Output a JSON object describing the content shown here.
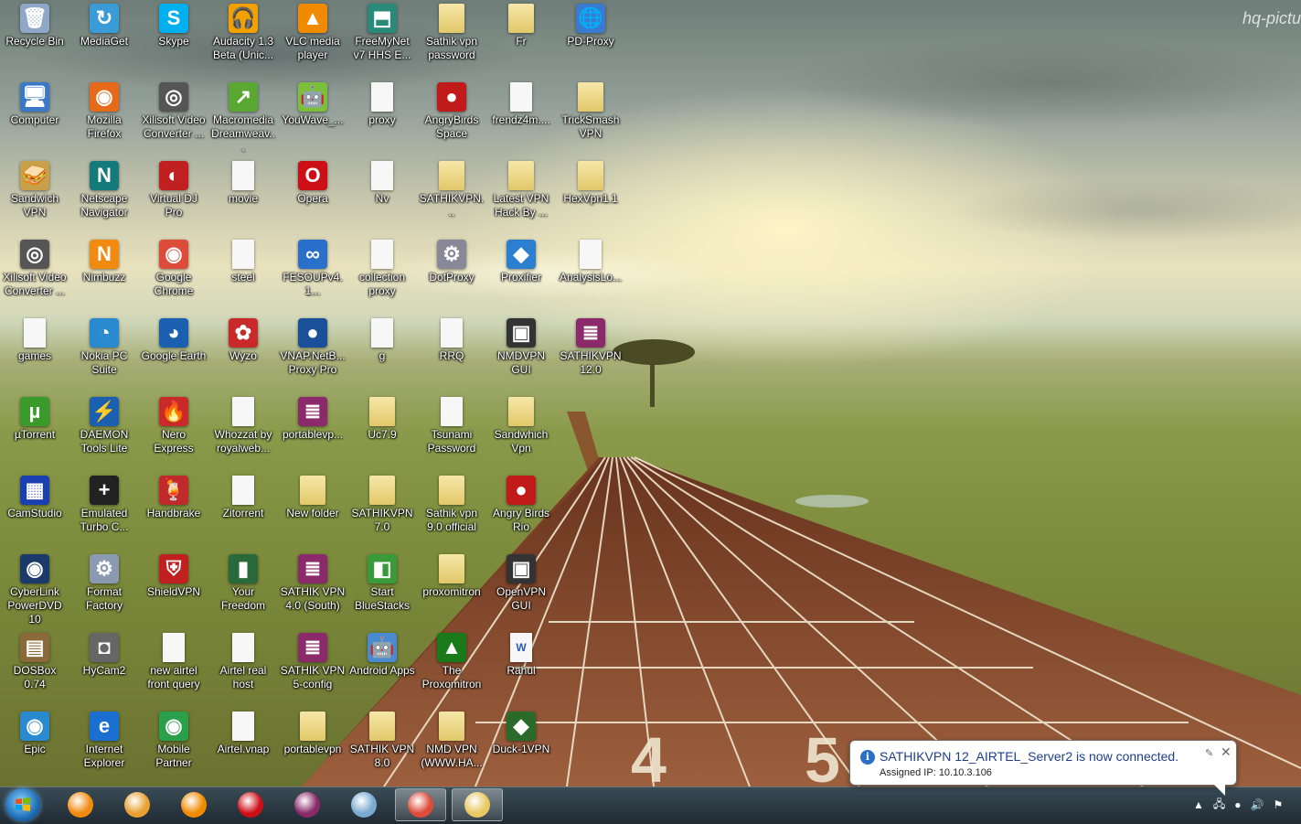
{
  "watermark": "hq-pictu",
  "icons": [
    {
      "label": "Recycle Bin",
      "icon": "recycle-bin-icon",
      "glyph": "🗑",
      "color": "#8fa8c8"
    },
    {
      "label": "MediaGet",
      "icon": "mediaget-icon",
      "glyph": "↻",
      "color": "#3a9bd9"
    },
    {
      "label": "Skype",
      "icon": "skype-icon",
      "glyph": "S",
      "color": "#00aff0"
    },
    {
      "label": "Audacity 1.3 Beta (Unic...",
      "icon": "audacity-icon",
      "glyph": "🎧",
      "color": "#f2a100"
    },
    {
      "label": "VLC media player",
      "icon": "vlc-icon",
      "glyph": "▲",
      "color": "#f08a00"
    },
    {
      "label": "FreeMyNet v7 HHS E...",
      "icon": "freemynet-icon",
      "glyph": "⬒",
      "color": "#2a8a7a"
    },
    {
      "label": "Sathik vpn password",
      "icon": "folder-icon",
      "glyph": "",
      "color": "#e8cf78",
      "kind": "fold"
    },
    {
      "label": "Fr",
      "icon": "folder-icon",
      "glyph": "",
      "color": "#e8cf78",
      "kind": "fold"
    },
    {
      "label": "PD-Proxy",
      "icon": "pd-proxy-icon",
      "glyph": "🌐",
      "color": "#3a7bd0"
    },
    {
      "label": "Computer",
      "icon": "computer-icon",
      "glyph": "🖥",
      "color": "#3a78c8"
    },
    {
      "label": "Mozilla Firefox",
      "icon": "firefox-icon",
      "glyph": "◉",
      "color": "#e66a1a"
    },
    {
      "label": "Xilisoft Video Converter ...",
      "icon": "xilisoft-icon",
      "glyph": "◎",
      "color": "#555"
    },
    {
      "label": "Macromedia Dreamweav...",
      "icon": "dreamweaver-icon",
      "glyph": "↗",
      "color": "#5aa832"
    },
    {
      "label": "YouWave_...",
      "icon": "youwave-icon",
      "glyph": "🤖",
      "color": "#7cbf3a"
    },
    {
      "label": "proxy",
      "icon": "document-icon",
      "glyph": "",
      "color": "#f7f7f7",
      "kind": "doc"
    },
    {
      "label": "AngryBirds Space",
      "icon": "angrybirds-space-icon",
      "glyph": "●",
      "color": "#c01a1a"
    },
    {
      "label": "frendz4m....",
      "icon": "document-icon",
      "glyph": "",
      "color": "#f7f7f7",
      "kind": "doc"
    },
    {
      "label": "TrickSmash VPN",
      "icon": "folder-icon",
      "glyph": "",
      "color": "#e8cf78",
      "kind": "fold"
    },
    {
      "label": "Sandwich VPN",
      "icon": "sandwich-vpn-icon",
      "glyph": "🥪",
      "color": "#c8a04a"
    },
    {
      "label": "Netscape Navigator",
      "icon": "netscape-icon",
      "glyph": "N",
      "color": "#147a7a"
    },
    {
      "label": "Virtual DJ Pro",
      "icon": "virtual-dj-icon",
      "glyph": "◐",
      "color": "#c02020"
    },
    {
      "label": "movie",
      "icon": "document-icon",
      "glyph": "",
      "color": "#f7f7f7",
      "kind": "doc"
    },
    {
      "label": "Opera",
      "icon": "opera-icon",
      "glyph": "O",
      "color": "#cc0f16"
    },
    {
      "label": "Nv",
      "icon": "document-icon",
      "glyph": "",
      "color": "#f7f7f7",
      "kind": "doc"
    },
    {
      "label": "SATHIKVPN...",
      "icon": "folder-icon",
      "glyph": "",
      "color": "#e8cf78",
      "kind": "fold"
    },
    {
      "label": "Latest VPN Hack By ...",
      "icon": "folder-icon",
      "glyph": "",
      "color": "#e8cf78",
      "kind": "fold"
    },
    {
      "label": "HexVpn1.1",
      "icon": "folder-icon",
      "glyph": "",
      "color": "#e8cf78",
      "kind": "fold"
    },
    {
      "label": "Xilisoft Video Converter ...",
      "icon": "xilisoft-icon",
      "glyph": "◎",
      "color": "#555"
    },
    {
      "label": "Nimbuzz",
      "icon": "nimbuzz-icon",
      "glyph": "N",
      "color": "#f08a10"
    },
    {
      "label": "Google Chrome",
      "icon": "chrome-icon",
      "glyph": "◉",
      "color": "#dd4b39"
    },
    {
      "label": "steel",
      "icon": "document-icon",
      "glyph": "",
      "color": "#f7f7f7",
      "kind": "doc"
    },
    {
      "label": "FESOUPv4.1...",
      "icon": "fesoup-icon",
      "glyph": "∞",
      "color": "#2a6fc9"
    },
    {
      "label": "collection proxy",
      "icon": "document-icon",
      "glyph": "",
      "color": "#f7f7f7",
      "kind": "doc"
    },
    {
      "label": "DotProxy",
      "icon": "dotproxy-icon",
      "glyph": "⚙",
      "color": "#889"
    },
    {
      "label": "Proxifier",
      "icon": "proxifier-icon",
      "glyph": "◆",
      "color": "#2a7fd0"
    },
    {
      "label": "AnalysisLo...",
      "icon": "document-icon",
      "glyph": "",
      "color": "#f7f7f7",
      "kind": "doc"
    },
    {
      "label": "games",
      "icon": "document-icon",
      "glyph": "",
      "color": "#f7f7f7",
      "kind": "doc"
    },
    {
      "label": "Nokia PC Suite",
      "icon": "nokia-icon",
      "glyph": "◔",
      "color": "#2a8ad0"
    },
    {
      "label": "Google Earth",
      "icon": "google-earth-icon",
      "glyph": "◕",
      "color": "#1a5fb0"
    },
    {
      "label": "Wyzo",
      "icon": "wyzo-icon",
      "glyph": "✿",
      "color": "#c82a2a"
    },
    {
      "label": "VNAP.NetB... Proxy Pro",
      "icon": "vnap-icon",
      "glyph": "●",
      "color": "#1a4f9a"
    },
    {
      "label": "g",
      "icon": "document-icon",
      "glyph": "",
      "color": "#f7f7f7",
      "kind": "doc"
    },
    {
      "label": "RRQ",
      "icon": "document-icon",
      "glyph": "",
      "color": "#f7f7f7",
      "kind": "doc"
    },
    {
      "label": "NMDVPN GUI",
      "icon": "nmdvpn-icon",
      "glyph": "▣",
      "color": "#333"
    },
    {
      "label": "SATHIKVPN 12.0",
      "icon": "winrar-icon",
      "glyph": "≣",
      "color": "#8a2a6a"
    },
    {
      "label": "µTorrent",
      "icon": "utorrent-icon",
      "glyph": "µ",
      "color": "#3a9a2a"
    },
    {
      "label": "DAEMON Tools Lite",
      "icon": "daemon-tools-icon",
      "glyph": "⚡",
      "color": "#1a5fb0"
    },
    {
      "label": "Nero Express",
      "icon": "nero-icon",
      "glyph": "🔥",
      "color": "#c82a2a"
    },
    {
      "label": "Whozzat by royalweb...",
      "icon": "html-file-icon",
      "glyph": "",
      "color": "#f7f7f7",
      "kind": "doc"
    },
    {
      "label": "portablevp...",
      "icon": "winrar-icon",
      "glyph": "≣",
      "color": "#8a2a6a"
    },
    {
      "label": "Uc7.9",
      "icon": "folder-icon",
      "glyph": "",
      "color": "#e8cf78",
      "kind": "fold"
    },
    {
      "label": "Tsunami Password",
      "icon": "document-icon",
      "glyph": "",
      "color": "#f7f7f7",
      "kind": "doc"
    },
    {
      "label": "Sandwhich Vpn",
      "icon": "folder-icon",
      "glyph": "",
      "color": "#e8cf78",
      "kind": "fold"
    },
    {
      "label": "CamStudio",
      "icon": "camstudio-icon",
      "glyph": "▦",
      "color": "#1a3fb0"
    },
    {
      "label": "Emulated Turbo C...",
      "icon": "turbo-c-icon",
      "glyph": "+",
      "color": "#222"
    },
    {
      "label": "Handbrake",
      "icon": "handbrake-icon",
      "glyph": "🍹",
      "color": "#c02a2a"
    },
    {
      "label": "Zitorrent",
      "icon": "document-icon",
      "glyph": "",
      "color": "#f7f7f7",
      "kind": "doc"
    },
    {
      "label": "New folder",
      "icon": "folder-icon",
      "glyph": "",
      "color": "#e8cf78",
      "kind": "fold"
    },
    {
      "label": "SATHIKVPN 7.0",
      "icon": "folder-icon",
      "glyph": "",
      "color": "#e8cf78",
      "kind": "fold"
    },
    {
      "label": "Sathik vpn 9.0 official",
      "icon": "folder-icon",
      "glyph": "",
      "color": "#e8cf78",
      "kind": "fold"
    },
    {
      "label": "Angry Birds Rio",
      "icon": "angrybirds-rio-icon",
      "glyph": "●",
      "color": "#c01a1a"
    },
    {
      "label": "CyberLink PowerDVD 10",
      "icon": "powerdvd-icon",
      "glyph": "◉",
      "color": "#1a3a6a"
    },
    {
      "label": "Format Factory",
      "icon": "format-factory-icon",
      "glyph": "⚙",
      "color": "#8a9ab0"
    },
    {
      "label": "ShieldVPN",
      "icon": "shieldvpn-icon",
      "glyph": "⛨",
      "color": "#c02020"
    },
    {
      "label": "Your Freedom",
      "icon": "your-freedom-icon",
      "glyph": "▮",
      "color": "#2a6a3a"
    },
    {
      "label": "SATHIK VPN 4.0 (South)",
      "icon": "winrar-icon",
      "glyph": "≣",
      "color": "#8a2a6a"
    },
    {
      "label": "Start BlueStacks",
      "icon": "bluestacks-icon",
      "glyph": "◧",
      "color": "#3a9a3a"
    },
    {
      "label": "proxomitron",
      "icon": "folder-icon",
      "glyph": "",
      "color": "#e8cf78",
      "kind": "fold"
    },
    {
      "label": "OpenVPN GUI",
      "icon": "openvpn-icon",
      "glyph": "▣",
      "color": "#333"
    },
    {
      "label": "DOSBox 0.74",
      "icon": "dosbox-icon",
      "glyph": "▤",
      "color": "#8a6a3a"
    },
    {
      "label": "HyCam2",
      "icon": "hycam-icon",
      "glyph": "◘",
      "color": "#666"
    },
    {
      "label": "new airtel front query",
      "icon": "document-icon",
      "glyph": "",
      "color": "#f7f7f7",
      "kind": "doc"
    },
    {
      "label": "Airtel real host",
      "icon": "document-icon",
      "glyph": "",
      "color": "#f7f7f7",
      "kind": "doc"
    },
    {
      "label": "SATHIK VPN 5-config",
      "icon": "winrar-icon",
      "glyph": "≣",
      "color": "#8a2a6a"
    },
    {
      "label": "Android Apps",
      "icon": "android-apps-icon",
      "glyph": "🤖",
      "color": "#4a8ad0"
    },
    {
      "label": "The Proxomitron",
      "icon": "proxomitron-icon",
      "glyph": "▲",
      "color": "#1a7a1a"
    },
    {
      "label": "Rahul",
      "icon": "word-doc-icon",
      "glyph": "W",
      "color": "#2a5ab0",
      "kind": "doc"
    },
    {
      "label": "Epic",
      "icon": "epic-icon",
      "glyph": "◉",
      "color": "#2a8ad0"
    },
    {
      "label": "Internet Explorer",
      "icon": "ie-icon",
      "glyph": "e",
      "color": "#1a6fd0"
    },
    {
      "label": "Mobile Partner",
      "icon": "mobile-partner-icon",
      "glyph": "◉",
      "color": "#2aa04a"
    },
    {
      "label": "Airtel.vnap",
      "icon": "document-icon",
      "glyph": "",
      "color": "#f7f7f7",
      "kind": "doc"
    },
    {
      "label": "portablevpn",
      "icon": "folder-icon",
      "glyph": "",
      "color": "#e8cf78",
      "kind": "fold"
    },
    {
      "label": "SATHIK VPN 8.0",
      "icon": "folder-icon",
      "glyph": "",
      "color": "#e8cf78",
      "kind": "fold"
    },
    {
      "label": "NMD VPN (WWW.HA...",
      "icon": "folder-icon",
      "glyph": "",
      "color": "#e8cf78",
      "kind": "fold"
    },
    {
      "label": "Duck-1VPN",
      "icon": "duck-vpn-icon",
      "glyph": "◆",
      "color": "#2a6a2a"
    }
  ],
  "taskbar": {
    "buttons": [
      {
        "name": "start-button",
        "icon": "windows-flag-icon"
      },
      {
        "name": "taskbar-nimbuzz",
        "icon": "nimbuzz-icon",
        "color": "#f08a10"
      },
      {
        "name": "taskbar-media-player",
        "icon": "media-player-icon",
        "color": "#e8a030"
      },
      {
        "name": "taskbar-vlc",
        "icon": "vlc-icon",
        "color": "#f08a00"
      },
      {
        "name": "taskbar-opera",
        "icon": "opera-icon",
        "color": "#cc0f16"
      },
      {
        "name": "taskbar-winrar",
        "icon": "winrar-icon",
        "color": "#8a2a6a"
      },
      {
        "name": "taskbar-notepad",
        "icon": "notepad-icon",
        "color": "#7aaad0"
      },
      {
        "name": "taskbar-chrome",
        "icon": "chrome-icon",
        "color": "#dd4b39",
        "active": true
      },
      {
        "name": "taskbar-explorer",
        "icon": "explorer-folder-icon",
        "color": "#e8c860",
        "active": true
      }
    ],
    "tray": [
      {
        "name": "tray-show-hidden",
        "icon": "chevron-up-icon",
        "glyph": "▲"
      },
      {
        "name": "tray-network",
        "icon": "network-icon",
        "glyph": "🖧"
      },
      {
        "name": "tray-vpn",
        "icon": "vpn-status-icon",
        "glyph": "●"
      },
      {
        "name": "tray-volume",
        "icon": "volume-icon",
        "glyph": "🔊"
      },
      {
        "name": "tray-flag",
        "icon": "action-center-icon",
        "glyph": "⚑"
      }
    ]
  },
  "notification": {
    "title": "SATHIKVPN 12_AIRTEL_Server2 is now connected.",
    "body": "Assigned IP: 10.10.3.106",
    "info_glyph": "i",
    "pin_glyph": "✎",
    "close_glyph": "✕"
  }
}
